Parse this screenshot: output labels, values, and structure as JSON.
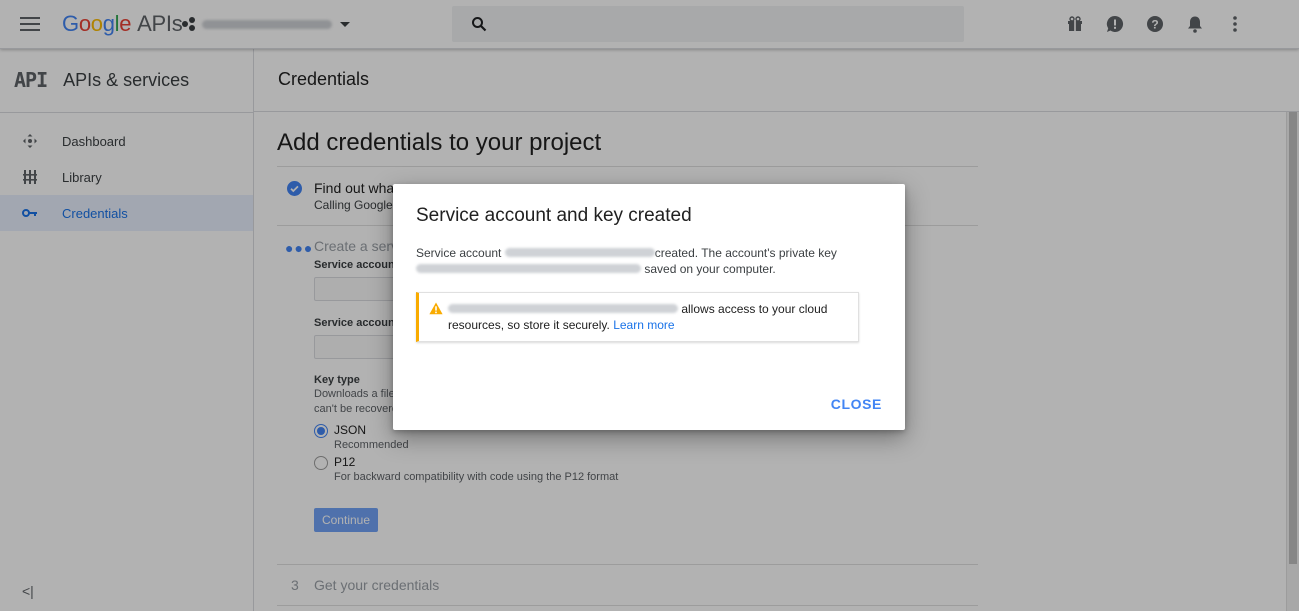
{
  "topbar": {
    "logo_letters": [
      "G",
      "o",
      "o",
      "g",
      "l",
      "e"
    ],
    "logo_suffix": "APIs"
  },
  "sidebar": {
    "header_mark": "API",
    "header_title": "APIs & services",
    "items": [
      {
        "label": "Dashboard",
        "icon": "dashboard-icon",
        "active": false
      },
      {
        "label": "Library",
        "icon": "library-icon",
        "active": false
      },
      {
        "label": "Credentials",
        "icon": "key-icon",
        "active": true
      }
    ],
    "collapse_glyph": "<|"
  },
  "main": {
    "page_title": "Credentials",
    "heading": "Add credentials to your project",
    "step1": {
      "title": "Find out wha",
      "subtitle": "Calling Google"
    },
    "step2": {
      "title": "Create a serv",
      "service_account_label": "Service account",
      "service_account_id_label": "Service account",
      "key_type_label": "Key type",
      "key_type_desc_1": "Downloads a file",
      "key_type_desc_2": "can't be recovere",
      "options": [
        {
          "label": "JSON",
          "sub": "Recommended",
          "selected": true
        },
        {
          "label": "P12",
          "sub": "For backward compatibility with code using the P12 format",
          "selected": false
        }
      ],
      "continue_label": "Continue"
    },
    "step3": {
      "number": "3",
      "title": "Get your credentials"
    }
  },
  "dialog": {
    "title": "Service account and key created",
    "body_prefix": "Service account",
    "body_mid": "created. The account's private key",
    "body_suffix": "saved on your computer.",
    "warning_text": "allows access to your cloud resources, so store it securely.",
    "warning_link": "Learn more",
    "close_label": "CLOSE"
  },
  "colors": {
    "accent": "#4285f4",
    "warning": "#f9ab00",
    "active_bg": "#e8f0fe"
  }
}
